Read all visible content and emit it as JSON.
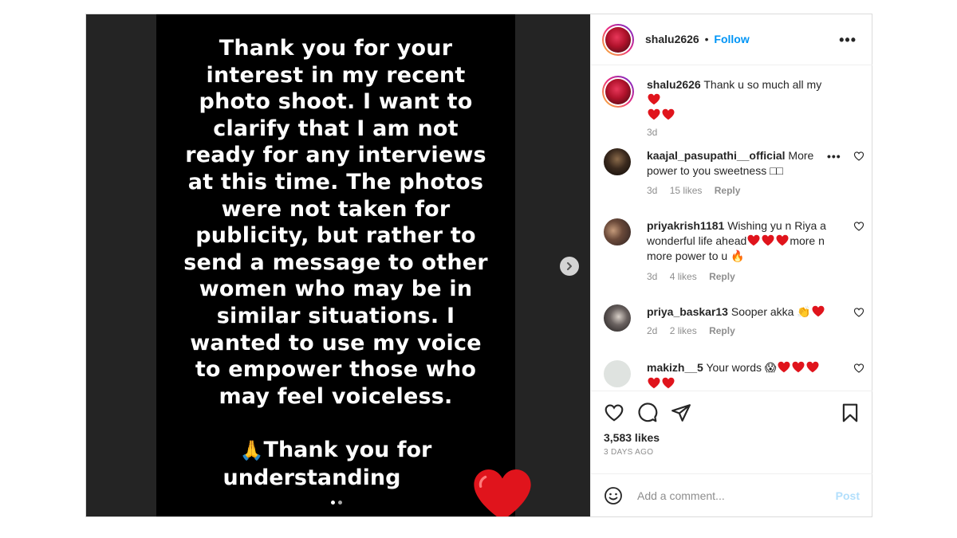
{
  "story": {
    "text": "Thank you for your\ninterest in my recent\nphoto shoot. I want to\nclarify that I am not\nready for any interviews\nat this time. The photos\nwere not taken for\npublicity, but rather to\nsend a message to other\nwomen who may be in\nsimilar situations. I\nwanted to use my voice\nto empower those who\nmay feel voiceless.",
    "thanks_emoji": "🙏",
    "thanks_line1": "Thank you for",
    "thanks_line2": "understanding",
    "big_heart_color": "#e0141c"
  },
  "carousel": {
    "current": 1,
    "total": 2
  },
  "header": {
    "username": "shalu2626",
    "separator": "•",
    "follow_label": "Follow",
    "more_label": "•••"
  },
  "comments": [
    {
      "username": "shalu2626",
      "text": "Thank u so much all my",
      "time": "3d"
    },
    {
      "username": "kaajal_pasupathi__official",
      "text": "More power to you sweetness",
      "trail": "□□",
      "time": "3d",
      "likes": "15 likes",
      "reply": "Reply"
    },
    {
      "username": "priyakrish1181",
      "text": "Wishing yu n Riya a wonderful life ahead",
      "text2": "more n more power to u",
      "fire": "🔥",
      "time": "3d",
      "likes": "4 likes",
      "reply": "Reply"
    },
    {
      "username": "priya_baskar13",
      "text": "Sooper akka",
      "clap": "👏",
      "time": "2d",
      "likes": "2 likes",
      "reply": "Reply"
    },
    {
      "username": "makizh__5",
      "text": "Your words",
      "emoji": "😱"
    }
  ],
  "actions": {
    "likes": "3,583 likes",
    "time": "3 DAYS AGO"
  },
  "comment_box": {
    "placeholder": "Add a comment...",
    "post_label": "Post"
  },
  "colors": {
    "accent": "#0095f6",
    "heart": "#e0141c",
    "post_disabled": "#b2dffc"
  }
}
